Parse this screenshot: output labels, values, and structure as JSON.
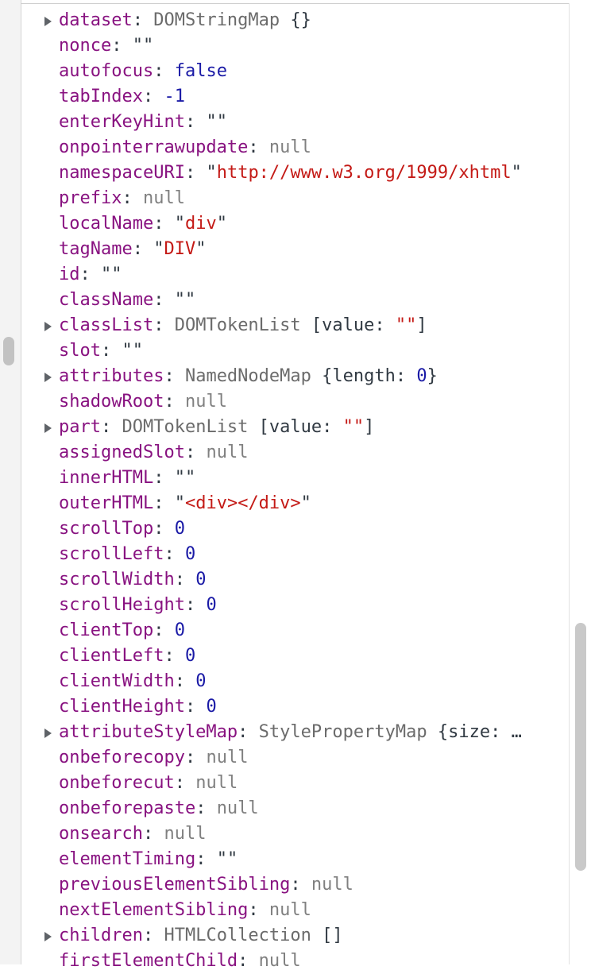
{
  "properties": [
    {
      "key": "dataset",
      "type": "obj",
      "expandable": true,
      "class_name": "DOMStringMap",
      "preview": "{}"
    },
    {
      "key": "nonce",
      "type": "str",
      "value": ""
    },
    {
      "key": "autofocus",
      "type": "num",
      "value": "false"
    },
    {
      "key": "tabIndex",
      "type": "num",
      "value": "-1"
    },
    {
      "key": "enterKeyHint",
      "type": "str",
      "value": ""
    },
    {
      "key": "onpointerrawupdate",
      "type": "null",
      "value": "null"
    },
    {
      "key": "namespaceURI",
      "type": "str",
      "value": "http://www.w3.org/1999/xhtml"
    },
    {
      "key": "prefix",
      "type": "null",
      "value": "null"
    },
    {
      "key": "localName",
      "type": "str",
      "value": "div"
    },
    {
      "key": "tagName",
      "type": "str",
      "value": "DIV"
    },
    {
      "key": "id",
      "type": "str",
      "value": ""
    },
    {
      "key": "className",
      "type": "str",
      "value": ""
    },
    {
      "key": "classList",
      "type": "obj",
      "expandable": true,
      "class_name": "DOMTokenList",
      "preview_parts": [
        {
          "t": "p",
          "v": " [value: "
        },
        {
          "t": "s",
          "v": "\"\""
        },
        {
          "t": "p",
          "v": "]"
        }
      ]
    },
    {
      "key": "slot",
      "type": "str",
      "value": ""
    },
    {
      "key": "attributes",
      "type": "obj",
      "expandable": true,
      "class_name": "NamedNodeMap",
      "preview_parts": [
        {
          "t": "p",
          "v": " {length: "
        },
        {
          "t": "n",
          "v": "0"
        },
        {
          "t": "p",
          "v": "}"
        }
      ]
    },
    {
      "key": "shadowRoot",
      "type": "null",
      "value": "null"
    },
    {
      "key": "part",
      "type": "obj",
      "expandable": true,
      "class_name": "DOMTokenList",
      "preview_parts": [
        {
          "t": "p",
          "v": " [value: "
        },
        {
          "t": "s",
          "v": "\"\""
        },
        {
          "t": "p",
          "v": "]"
        }
      ]
    },
    {
      "key": "assignedSlot",
      "type": "null",
      "value": "null"
    },
    {
      "key": "innerHTML",
      "type": "str",
      "value": ""
    },
    {
      "key": "outerHTML",
      "type": "str",
      "value": "<div></div>"
    },
    {
      "key": "scrollTop",
      "type": "num",
      "value": "0"
    },
    {
      "key": "scrollLeft",
      "type": "num",
      "value": "0"
    },
    {
      "key": "scrollWidth",
      "type": "num",
      "value": "0"
    },
    {
      "key": "scrollHeight",
      "type": "num",
      "value": "0"
    },
    {
      "key": "clientTop",
      "type": "num",
      "value": "0"
    },
    {
      "key": "clientLeft",
      "type": "num",
      "value": "0"
    },
    {
      "key": "clientWidth",
      "type": "num",
      "value": "0"
    },
    {
      "key": "clientHeight",
      "type": "num",
      "value": "0"
    },
    {
      "key": "attributeStyleMap",
      "type": "obj",
      "expandable": true,
      "class_name": "StylePropertyMap",
      "preview_parts": [
        {
          "t": "p",
          "v": " {size: "
        },
        {
          "t": "ell",
          "v": "…"
        }
      ]
    },
    {
      "key": "onbeforecopy",
      "type": "null",
      "value": "null"
    },
    {
      "key": "onbeforecut",
      "type": "null",
      "value": "null"
    },
    {
      "key": "onbeforepaste",
      "type": "null",
      "value": "null"
    },
    {
      "key": "onsearch",
      "type": "null",
      "value": "null"
    },
    {
      "key": "elementTiming",
      "type": "str",
      "value": ""
    },
    {
      "key": "previousElementSibling",
      "type": "null",
      "value": "null"
    },
    {
      "key": "nextElementSibling",
      "type": "null",
      "value": "null"
    },
    {
      "key": "children",
      "type": "obj",
      "expandable": true,
      "class_name": "HTMLCollection",
      "preview": "[]"
    },
    {
      "key": "firstElementChild",
      "type": "null",
      "value": "null"
    }
  ],
  "colors": {
    "key": "#881280",
    "string": "#c41a16",
    "number": "#1a1aa6",
    "null": "#808080",
    "object_type": "#6b6b6b"
  }
}
